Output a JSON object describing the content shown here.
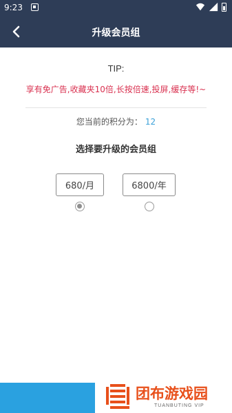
{
  "status_bar": {
    "time": "9:23",
    "icons": [
      "notification-icon",
      "wifi-icon",
      "signal-icon",
      "battery-icon"
    ]
  },
  "header": {
    "title": "升级会员组",
    "back_icon": "chevron-left-icon"
  },
  "tip": {
    "heading": "TIP:",
    "text": "享有免广告,收藏夹10倍,长按倍速,投屏,缓存等!~"
  },
  "points": {
    "label": "您当前的积分为：",
    "value": "12"
  },
  "select_heading": "选择要升级的会员组",
  "options": [
    {
      "label": "680/月",
      "selected": true
    },
    {
      "label": "6800/年",
      "selected": false
    }
  ],
  "watermark": {
    "text": "团布游戏园",
    "sub": "TUANBUTING VIP"
  },
  "colors": {
    "header_bg": "#2e3d57",
    "tip_text": "#d9304f",
    "points_value": "#3aa0d8",
    "bottom_bar": "#2aa1e0",
    "watermark": "#e8501b"
  }
}
